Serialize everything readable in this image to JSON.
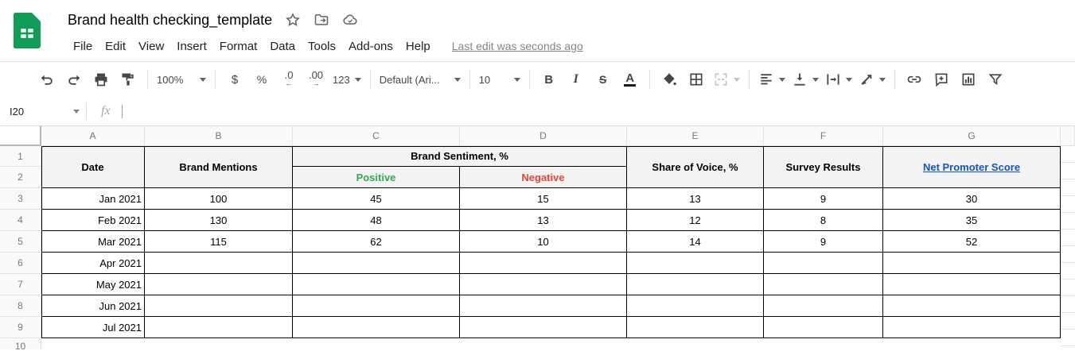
{
  "titlebar": {
    "title": "Brand health checking_template",
    "menus": [
      "File",
      "Edit",
      "View",
      "Insert",
      "Format",
      "Data",
      "Tools",
      "Add-ons",
      "Help"
    ],
    "last_edit": "Last edit was seconds ago"
  },
  "toolbar": {
    "zoom": "100%",
    "currency": "$",
    "percent": "%",
    "decrease_decimal": ".0",
    "decrease_decimal_arrow": "←",
    "increase_decimal": ".00",
    "increase_decimal_arrow": "→",
    "number_format": "123",
    "font_name": "Default (Ari...",
    "font_size": "10",
    "bold": "B",
    "italic": "I",
    "strikethrough": "S",
    "text_color": "A"
  },
  "formula_bar": {
    "name_box": "I20",
    "fx": "fx"
  },
  "sheet": {
    "col_letters": [
      "A",
      "B",
      "C",
      "D",
      "E",
      "F",
      "G"
    ],
    "row_numbers": [
      "1",
      "2",
      "3",
      "4",
      "5",
      "6",
      "7",
      "8",
      "9",
      "10"
    ],
    "colors": {
      "positive": "#34a853",
      "negative": "#ea4335",
      "link": "#1155cc",
      "header_fill": "#f3f3f3"
    },
    "header_cells": [
      {
        "label": "Date",
        "c0": 0,
        "c1": 0,
        "r0": 0,
        "r1": 1,
        "style": "plain"
      },
      {
        "label": "Brand Mentions",
        "c0": 1,
        "c1": 1,
        "r0": 0,
        "r1": 1,
        "style": "plain"
      },
      {
        "label": "Brand Sentiment, %",
        "c0": 2,
        "c1": 3,
        "r0": 0,
        "r1": 0,
        "style": "plain"
      },
      {
        "label": "Positive",
        "c0": 2,
        "c1": 2,
        "r0": 1,
        "r1": 1,
        "style": "positive"
      },
      {
        "label": "Negative",
        "c0": 3,
        "c1": 3,
        "r0": 1,
        "r1": 1,
        "style": "negative"
      },
      {
        "label": "Share of Voice, %",
        "c0": 4,
        "c1": 4,
        "r0": 0,
        "r1": 1,
        "style": "plain"
      },
      {
        "label": "Survey Results",
        "c0": 5,
        "c1": 5,
        "r0": 0,
        "r1": 1,
        "style": "plain"
      },
      {
        "label": "Net Promoter Score",
        "c0": 6,
        "c1": 6,
        "r0": 0,
        "r1": 1,
        "style": "link"
      }
    ],
    "data_rows": [
      {
        "n": "3",
        "cells": [
          "Jan 2021",
          "100",
          "45",
          "15",
          "13",
          "9",
          "30"
        ]
      },
      {
        "n": "4",
        "cells": [
          "Feb 2021",
          "130",
          "48",
          "13",
          "12",
          "8",
          "35"
        ]
      },
      {
        "n": "5",
        "cells": [
          "Mar 2021",
          "115",
          "62",
          "10",
          "14",
          "9",
          "52"
        ]
      },
      {
        "n": "6",
        "cells": [
          "Apr 2021",
          "",
          "",
          "",
          "",
          "",
          ""
        ]
      },
      {
        "n": "7",
        "cells": [
          "May 2021",
          "",
          "",
          "",
          "",
          "",
          ""
        ]
      },
      {
        "n": "8",
        "cells": [
          "Jun 2021",
          "",
          "",
          "",
          "",
          "",
          ""
        ]
      },
      {
        "n": "9",
        "cells": [
          "Jul 2021",
          "",
          "",
          "",
          "",
          "",
          ""
        ]
      }
    ]
  }
}
